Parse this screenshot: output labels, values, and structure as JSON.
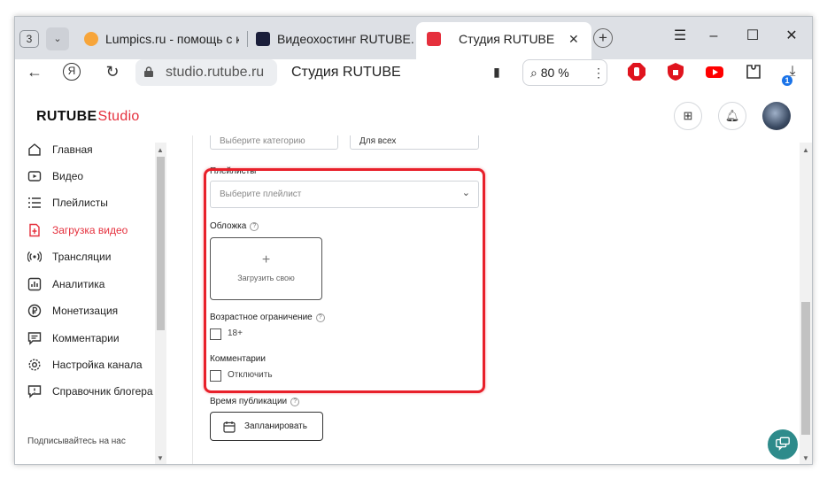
{
  "browser": {
    "tab_count": "3",
    "tabs": [
      {
        "title": "Lumpics.ru - помощь с к"
      },
      {
        "title": "Видеохостинг RUTUBE. С"
      },
      {
        "title": "Студия RUTUBE"
      }
    ],
    "url": "studio.rutube.ru",
    "page_title": "Студия RUTUBE",
    "zoom": "80 %",
    "download_badge": "1"
  },
  "app": {
    "logo_main": "RUTUBE",
    "logo_sub": "Studio"
  },
  "sidebar": {
    "items": [
      {
        "label": "Главная",
        "active": false
      },
      {
        "label": "Видео",
        "active": false
      },
      {
        "label": "Плейлисты",
        "active": false
      },
      {
        "label": "Загрузка видео",
        "active": true
      },
      {
        "label": "Трансляции",
        "active": false
      },
      {
        "label": "Аналитика",
        "active": false
      },
      {
        "label": "Монетизация",
        "active": false
      },
      {
        "label": "Комментарии",
        "active": false
      },
      {
        "label": "Настройка канала",
        "active": false
      },
      {
        "label": "Справочник блогера",
        "active": false
      }
    ],
    "subscribe_label": "Подписывайтесь на нас"
  },
  "form": {
    "category_placeholder": "Выберите категорию",
    "audience_value": "Для всех",
    "playlists_label": "Плейлисты",
    "playlists_placeholder": "Выберите плейлист",
    "cover_label": "Обложка",
    "cover_upload": "Загрузить свою",
    "age_label": "Возрастное ограничение",
    "age_option": "18+",
    "comments_label": "Комментарии",
    "comments_option": "Отключить",
    "publish_time_label": "Время публикации",
    "schedule_button": "Запланировать"
  },
  "colors": {
    "accent": "#e5303d",
    "highlight": "#e8202a"
  }
}
